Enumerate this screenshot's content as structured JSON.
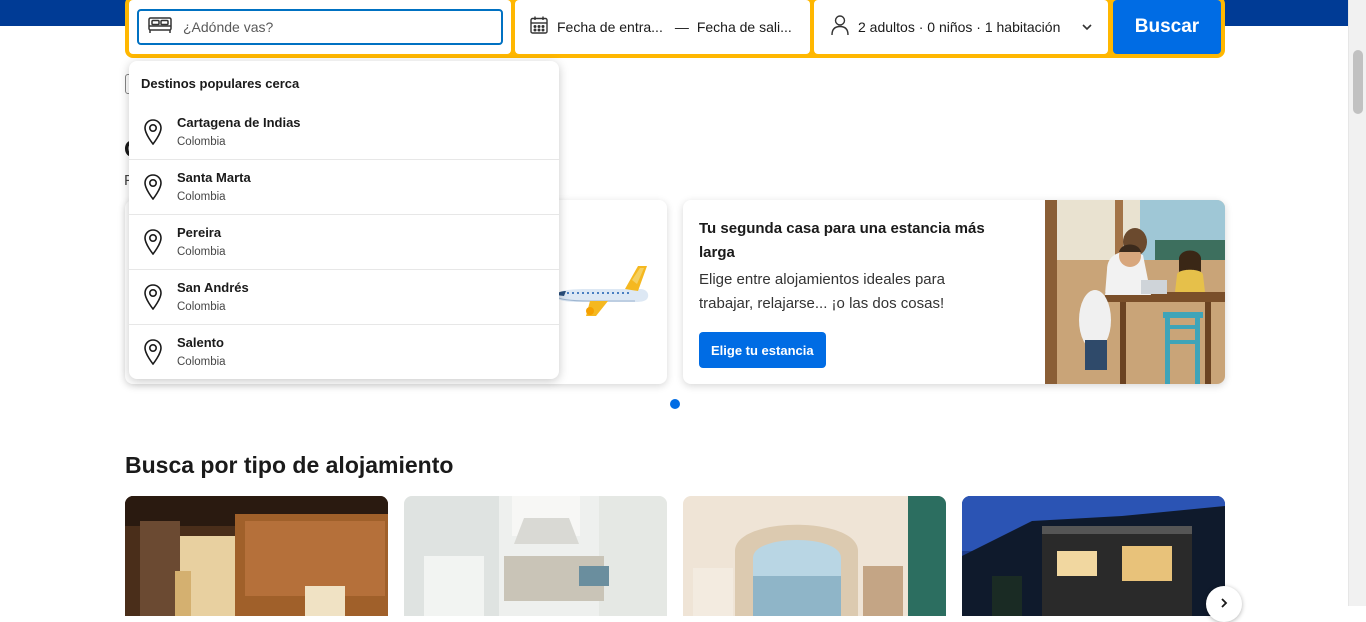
{
  "search": {
    "destination_placeholder": "¿Adónde vas?",
    "destination_value": "",
    "checkin_label": "Fecha de entra...",
    "date_separator": "—",
    "checkout_label": "Fecha de sali...",
    "guests_label": "2 adultos · 0 niños · 1 habitación",
    "search_button": "Buscar"
  },
  "dropdown": {
    "title": "Destinos populares cerca",
    "items": [
      {
        "name": "Cartagena de Indias",
        "country": "Colombia"
      },
      {
        "name": "Santa Marta",
        "country": "Colombia"
      },
      {
        "name": "Pereira",
        "country": "Colombia"
      },
      {
        "name": "San Andrés",
        "country": "Colombia"
      },
      {
        "name": "Salento",
        "country": "Colombia"
      }
    ]
  },
  "promo_card": {
    "title": "Tu segunda casa para una estancia más larga",
    "description": "Elige entre alojamientos ideales para trabajar, relajarse... ¡o las dos cosas!",
    "button": "Elige tu estancia"
  },
  "section": {
    "title": "Busca por tipo de alojamiento"
  },
  "colors": {
    "brand_blue": "#003b95",
    "accent_yellow": "#ffb700",
    "button_blue": "#006ce4"
  },
  "page_letters": {
    "heading_peek": "O",
    "subtext_peek": "P"
  }
}
